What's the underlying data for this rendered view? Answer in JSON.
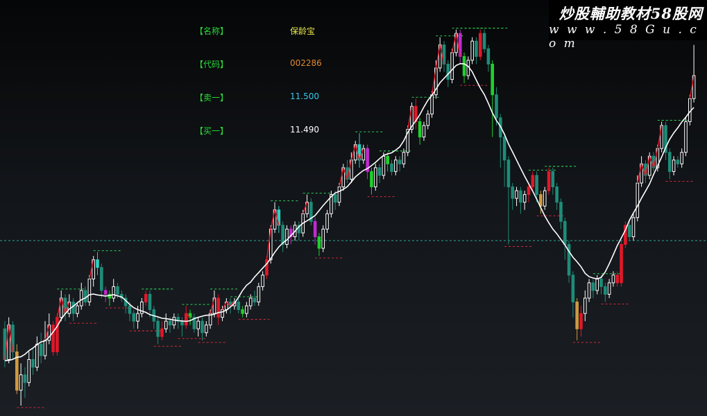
{
  "info_panel": {
    "rows": [
      {
        "label": "【名称】",
        "value": "保龄宝",
        "color": "#e8e84a"
      },
      {
        "label": "【代码】",
        "value": "002286",
        "color": "#e08a33"
      },
      {
        "label": "【卖一】",
        "value": "11.500",
        "color": "#39c6e6"
      },
      {
        "label": "【买一】",
        "value": "11.490",
        "color": "#ffffff"
      }
    ]
  },
  "watermark": {
    "title": "炒股輔助教材58股网",
    "url": "w w w . 5 8 G u . c o m"
  },
  "chart_data": {
    "type": "candlestick",
    "title": "",
    "xlabel": "",
    "ylabel": "",
    "grid": false,
    "reference_line": {
      "value": 11.5,
      "color": "#2aa89a",
      "style": "dashed"
    },
    "trend_line": {
      "color": "#ffffff"
    },
    "up_color": "#ffffff",
    "down_color": "#1e8c78",
    "signal_colors": {
      "red": "#e0182a",
      "green": "#1fd02a",
      "magenta": "#c02ad0",
      "cyan": "#2ad0c0",
      "orange": "#d09a40"
    },
    "candles": [
      [
        9.2,
        8.4,
        9.4,
        8.2,
        ""
      ],
      [
        8.4,
        9.3,
        9.5,
        8.3,
        ""
      ],
      [
        9.3,
        8.6,
        9.4,
        8.4,
        ""
      ],
      [
        8.6,
        7.6,
        8.8,
        7.5,
        "orange"
      ],
      [
        7.6,
        8.0,
        8.3,
        7.2,
        ""
      ],
      [
        8.0,
        7.8,
        8.2,
        7.4,
        ""
      ],
      [
        7.8,
        8.4,
        8.6,
        7.7,
        ""
      ],
      [
        8.4,
        8.2,
        8.7,
        8.0,
        ""
      ],
      [
        8.2,
        8.8,
        9.0,
        8.1,
        ""
      ],
      [
        8.8,
        8.5,
        9.1,
        8.3,
        ""
      ],
      [
        8.5,
        8.9,
        9.4,
        8.4,
        ""
      ],
      [
        8.9,
        9.3,
        9.6,
        8.8,
        ""
      ],
      [
        9.3,
        8.6,
        9.4,
        8.5,
        "red"
      ],
      [
        8.6,
        9.5,
        9.6,
        8.5,
        "red"
      ],
      [
        9.5,
        10.0,
        10.2,
        9.4,
        ""
      ],
      [
        10.0,
        9.6,
        10.1,
        9.4,
        ""
      ],
      [
        9.6,
        9.9,
        10.1,
        9.5,
        ""
      ],
      [
        9.9,
        9.6,
        10.0,
        9.4,
        ""
      ],
      [
        9.6,
        9.8,
        9.9,
        9.5,
        ""
      ],
      [
        9.8,
        10.2,
        10.4,
        9.7,
        ""
      ],
      [
        10.2,
        9.9,
        10.3,
        9.8,
        ""
      ],
      [
        9.9,
        10.5,
        10.6,
        9.8,
        ""
      ],
      [
        10.5,
        11.0,
        11.1,
        10.3,
        ""
      ],
      [
        11.0,
        10.8,
        11.2,
        10.6,
        "cyan"
      ],
      [
        10.8,
        10.2,
        10.9,
        10.0,
        ""
      ],
      [
        10.2,
        10.1,
        10.3,
        9.9,
        "magenta"
      ],
      [
        10.1,
        10.0,
        10.2,
        9.8,
        "green"
      ],
      [
        10.0,
        10.3,
        10.5,
        9.9,
        ""
      ],
      [
        10.3,
        10.1,
        10.4,
        10.0,
        ""
      ],
      [
        10.1,
        10.0,
        10.2,
        9.9,
        ""
      ],
      [
        10.0,
        9.8,
        10.1,
        9.6,
        ""
      ],
      [
        9.8,
        9.6,
        9.9,
        9.4,
        ""
      ],
      [
        9.6,
        9.4,
        9.7,
        9.2,
        ""
      ],
      [
        9.4,
        9.6,
        9.8,
        9.2,
        ""
      ],
      [
        9.6,
        9.9,
        10.0,
        9.5,
        ""
      ],
      [
        9.9,
        10.1,
        10.2,
        9.8,
        "red"
      ],
      [
        10.1,
        9.7,
        10.2,
        9.5,
        ""
      ],
      [
        9.7,
        9.4,
        9.8,
        9.2,
        ""
      ],
      [
        9.4,
        9.0,
        9.5,
        8.8,
        ""
      ],
      [
        9.0,
        9.2,
        9.4,
        8.9,
        "red"
      ],
      [
        9.2,
        9.4,
        9.6,
        9.1,
        ""
      ],
      [
        9.4,
        9.3,
        9.5,
        9.1,
        ""
      ],
      [
        9.3,
        9.5,
        9.6,
        9.2,
        ""
      ],
      [
        9.5,
        9.4,
        9.6,
        9.2,
        ""
      ],
      [
        9.4,
        9.3,
        9.5,
        9.0,
        ""
      ],
      [
        9.3,
        9.6,
        9.8,
        9.2,
        "red"
      ],
      [
        9.6,
        9.5,
        9.7,
        9.3,
        "green"
      ],
      [
        9.5,
        9.2,
        9.6,
        9.1,
        ""
      ],
      [
        9.2,
        9.4,
        9.5,
        9.0,
        ""
      ],
      [
        9.4,
        9.1,
        9.5,
        8.9,
        ""
      ],
      [
        9.1,
        9.3,
        9.4,
        9.0,
        ""
      ],
      [
        9.3,
        9.6,
        9.7,
        9.2,
        ""
      ],
      [
        9.6,
        10.0,
        10.2,
        9.5,
        ""
      ],
      [
        10.0,
        9.5,
        10.1,
        9.3,
        "red"
      ],
      [
        9.5,
        9.7,
        9.8,
        9.4,
        ""
      ],
      [
        9.7,
        9.9,
        10.0,
        9.6,
        ""
      ],
      [
        9.9,
        9.8,
        10.0,
        9.6,
        ""
      ],
      [
        9.8,
        9.9,
        10.0,
        9.7,
        ""
      ],
      [
        9.9,
        9.7,
        10.0,
        9.6,
        ""
      ],
      [
        9.7,
        9.6,
        9.8,
        9.5,
        "green"
      ],
      [
        9.6,
        9.8,
        9.9,
        9.5,
        ""
      ],
      [
        9.8,
        10.0,
        10.1,
        9.7,
        ""
      ],
      [
        10.0,
        9.9,
        10.2,
        9.8,
        ""
      ],
      [
        9.9,
        10.3,
        10.4,
        9.8,
        ""
      ],
      [
        10.3,
        10.6,
        10.7,
        10.2,
        ""
      ],
      [
        10.6,
        11.0,
        11.1,
        10.5,
        "red"
      ],
      [
        11.0,
        11.8,
        11.9,
        10.9,
        ""
      ],
      [
        11.8,
        12.3,
        12.5,
        11.7,
        ""
      ],
      [
        12.3,
        11.9,
        12.4,
        11.7,
        "cyan"
      ],
      [
        11.9,
        11.4,
        12.0,
        11.2,
        ""
      ],
      [
        11.4,
        11.8,
        11.9,
        11.3,
        ""
      ],
      [
        11.8,
        11.6,
        11.9,
        11.4,
        "magenta"
      ],
      [
        11.6,
        11.9,
        12.0,
        11.5,
        ""
      ],
      [
        11.9,
        11.7,
        12.0,
        11.5,
        ""
      ],
      [
        11.7,
        12.2,
        12.3,
        11.6,
        ""
      ],
      [
        12.2,
        12.5,
        12.7,
        12.1,
        ""
      ],
      [
        12.5,
        12.0,
        12.6,
        11.9,
        ""
      ],
      [
        12.0,
        11.6,
        12.1,
        11.4,
        "magenta"
      ],
      [
        11.6,
        11.3,
        11.7,
        11.1,
        "green"
      ],
      [
        11.3,
        11.8,
        11.9,
        11.2,
        ""
      ],
      [
        11.8,
        12.2,
        12.3,
        11.7,
        ""
      ],
      [
        12.2,
        12.7,
        12.8,
        12.1,
        ""
      ],
      [
        12.7,
        12.5,
        12.8,
        12.3,
        ""
      ],
      [
        12.5,
        12.9,
        13.0,
        12.4,
        ""
      ],
      [
        12.9,
        13.4,
        13.5,
        12.8,
        ""
      ],
      [
        13.4,
        13.1,
        13.6,
        13.0,
        ""
      ],
      [
        13.1,
        13.6,
        13.8,
        13.0,
        ""
      ],
      [
        13.6,
        14.0,
        14.1,
        13.5,
        ""
      ],
      [
        14.0,
        13.6,
        14.3,
        13.4,
        "cyan"
      ],
      [
        13.6,
        13.9,
        14.0,
        13.5,
        ""
      ],
      [
        13.9,
        13.3,
        14.0,
        13.1,
        "magenta"
      ],
      [
        13.3,
        12.9,
        13.4,
        12.7,
        "green"
      ],
      [
        12.9,
        13.4,
        13.5,
        12.8,
        ""
      ],
      [
        13.4,
        13.2,
        13.5,
        13.0,
        ""
      ],
      [
        13.2,
        13.7,
        13.8,
        13.1,
        ""
      ],
      [
        13.7,
        13.5,
        13.8,
        13.3,
        "green"
      ],
      [
        13.5,
        13.3,
        13.6,
        13.2,
        ""
      ],
      [
        13.3,
        13.6,
        13.7,
        13.2,
        ""
      ],
      [
        13.6,
        13.5,
        13.7,
        13.3,
        ""
      ],
      [
        13.5,
        13.8,
        13.9,
        13.4,
        ""
      ],
      [
        13.8,
        14.4,
        14.5,
        13.7,
        ""
      ],
      [
        14.4,
        15.0,
        15.1,
        14.3,
        ""
      ],
      [
        15.0,
        14.6,
        15.2,
        14.4,
        "red"
      ],
      [
        14.6,
        14.2,
        14.7,
        14.0,
        "green"
      ],
      [
        14.2,
        14.5,
        14.6,
        14.1,
        ""
      ],
      [
        14.5,
        14.8,
        14.9,
        14.4,
        ""
      ],
      [
        14.8,
        15.3,
        15.4,
        14.7,
        ""
      ],
      [
        15.3,
        16.0,
        16.2,
        15.2,
        ""
      ],
      [
        16.0,
        16.6,
        16.8,
        15.9,
        ""
      ],
      [
        16.6,
        16.1,
        16.7,
        15.9,
        ""
      ],
      [
        16.1,
        15.7,
        16.2,
        15.5,
        ""
      ],
      [
        15.7,
        16.4,
        16.5,
        15.6,
        ""
      ],
      [
        16.4,
        16.9,
        17.0,
        16.3,
        ""
      ],
      [
        16.9,
        16.3,
        17.0,
        16.1,
        "magenta"
      ],
      [
        16.3,
        15.8,
        16.4,
        15.6,
        "green"
      ],
      [
        15.8,
        16.2,
        16.3,
        15.7,
        ""
      ],
      [
        16.2,
        16.7,
        16.8,
        16.1,
        ""
      ],
      [
        16.7,
        16.3,
        16.8,
        16.1,
        ""
      ],
      [
        16.3,
        16.9,
        17.0,
        16.2,
        "red"
      ],
      [
        16.9,
        16.5,
        17.0,
        16.4,
        ""
      ],
      [
        16.5,
        16.1,
        16.6,
        15.9,
        ""
      ],
      [
        16.1,
        15.3,
        16.2,
        14.2,
        "green"
      ],
      [
        15.3,
        14.7,
        15.5,
        14.5,
        ""
      ],
      [
        14.7,
        14.2,
        14.8,
        13.4,
        ""
      ],
      [
        14.2,
        13.6,
        14.3,
        12.9,
        ""
      ],
      [
        13.6,
        12.9,
        13.7,
        11.4,
        ""
      ],
      [
        12.9,
        12.6,
        13.0,
        12.3,
        ""
      ],
      [
        12.6,
        12.8,
        12.9,
        12.4,
        ""
      ],
      [
        12.8,
        12.5,
        12.9,
        12.2,
        ""
      ],
      [
        12.5,
        12.7,
        12.8,
        12.3,
        ""
      ],
      [
        12.7,
        12.9,
        13.0,
        12.5,
        "red"
      ],
      [
        12.9,
        13.2,
        13.3,
        12.8,
        "red"
      ],
      [
        13.2,
        12.7,
        13.3,
        12.5,
        ""
      ],
      [
        12.7,
        12.4,
        12.8,
        12.2,
        "orange"
      ],
      [
        12.4,
        12.8,
        12.9,
        12.3,
        ""
      ],
      [
        12.8,
        13.3,
        13.4,
        12.7,
        "red"
      ],
      [
        13.3,
        12.9,
        13.4,
        12.7,
        ""
      ],
      [
        12.9,
        12.5,
        13.0,
        12.3,
        ""
      ],
      [
        12.5,
        12.0,
        12.6,
        11.8,
        ""
      ],
      [
        12.0,
        11.4,
        12.1,
        11.0,
        ""
      ],
      [
        11.4,
        10.6,
        11.5,
        10.4,
        ""
      ],
      [
        10.6,
        9.9,
        10.7,
        9.5,
        ""
      ],
      [
        9.9,
        9.2,
        10.0,
        8.9,
        "orange"
      ],
      [
        9.2,
        9.6,
        9.8,
        9.0,
        "red"
      ],
      [
        9.6,
        10.0,
        10.2,
        9.4,
        ""
      ],
      [
        10.0,
        10.4,
        10.5,
        9.9,
        ""
      ],
      [
        10.4,
        10.2,
        10.5,
        10.0,
        ""
      ],
      [
        10.2,
        10.5,
        10.6,
        10.1,
        ""
      ],
      [
        10.5,
        10.3,
        10.6,
        10.1,
        ""
      ],
      [
        10.3,
        10.1,
        10.4,
        9.9,
        ""
      ],
      [
        10.1,
        10.4,
        10.5,
        10.0,
        ""
      ],
      [
        10.4,
        10.6,
        10.7,
        10.3,
        ""
      ],
      [
        10.6,
        10.4,
        10.7,
        10.3,
        "red"
      ],
      [
        10.4,
        11.4,
        11.5,
        10.3,
        "red"
      ],
      [
        11.4,
        11.9,
        12.0,
        11.3,
        "red"
      ],
      [
        11.9,
        11.6,
        12.0,
        11.5,
        ""
      ],
      [
        11.6,
        12.1,
        12.2,
        11.5,
        ""
      ],
      [
        12.1,
        13.0,
        13.2,
        12.0,
        ""
      ],
      [
        13.0,
        13.5,
        13.7,
        12.9,
        ""
      ],
      [
        13.5,
        13.2,
        13.6,
        13.0,
        ""
      ],
      [
        13.2,
        13.7,
        13.8,
        13.1,
        ""
      ],
      [
        13.7,
        13.4,
        13.8,
        13.3,
        ""
      ],
      [
        13.4,
        13.9,
        14.0,
        13.3,
        ""
      ],
      [
        13.9,
        14.5,
        14.6,
        13.8,
        ""
      ],
      [
        14.5,
        13.8,
        14.6,
        13.6,
        ""
      ],
      [
        13.8,
        13.3,
        13.9,
        13.1,
        ""
      ],
      [
        13.3,
        13.6,
        13.7,
        13.2,
        ""
      ],
      [
        13.6,
        13.5,
        13.7,
        13.4,
        ""
      ],
      [
        13.5,
        13.8,
        13.9,
        13.4,
        ""
      ],
      [
        13.8,
        14.6,
        14.7,
        13.7,
        ""
      ],
      [
        14.6,
        15.2,
        15.3,
        14.5,
        ""
      ],
      [
        15.2,
        15.8,
        16.6,
        15.1,
        ""
      ]
    ]
  }
}
